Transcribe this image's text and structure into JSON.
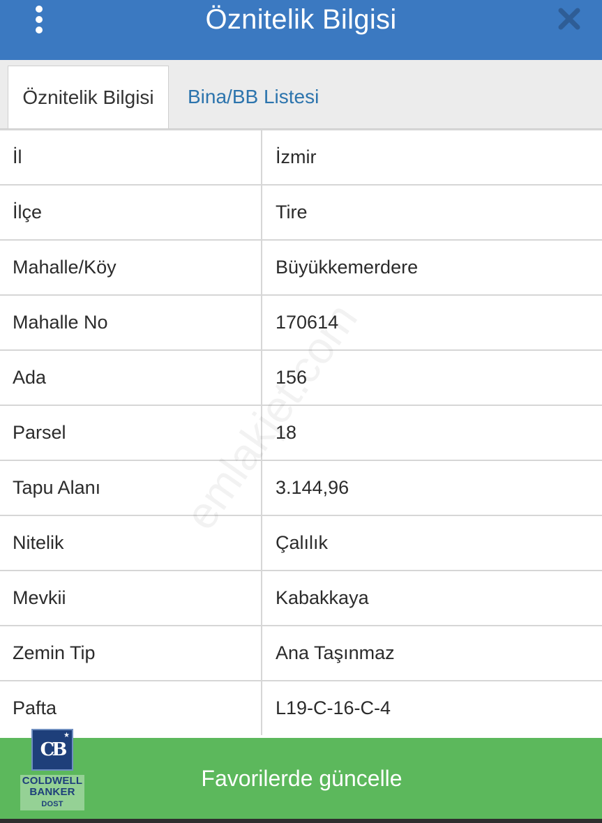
{
  "header": {
    "title": "Öznitelik Bilgisi",
    "menu_icon": "more-vertical-icon",
    "close_icon": "close-icon"
  },
  "tabs": [
    {
      "label": "Öznitelik Bilgisi",
      "active": true
    },
    {
      "label": "Bina/BB Listesi",
      "active": false
    }
  ],
  "attributes": [
    {
      "label": "İl",
      "value": "İzmir"
    },
    {
      "label": "İlçe",
      "value": "Tire"
    },
    {
      "label": "Mahalle/Köy",
      "value": "Büyükkemerdere"
    },
    {
      "label": "Mahalle No",
      "value": "170614"
    },
    {
      "label": "Ada",
      "value": "156"
    },
    {
      "label": "Parsel",
      "value": "18"
    },
    {
      "label": "Tapu Alanı",
      "value": "3.144,96"
    },
    {
      "label": "Nitelik",
      "value": "Çalılık"
    },
    {
      "label": "Mevkii",
      "value": "Kabakkaya"
    },
    {
      "label": "Zemin Tip",
      "value": "Ana Taşınmaz"
    },
    {
      "label": "Pafta",
      "value": "L19-C-16-C-4"
    }
  ],
  "watermark": "emlakjet.com",
  "footer": {
    "button_label": "Favorilerde güncelle"
  },
  "logo": {
    "monogram": "CB",
    "line1": "COLDWELL",
    "line2": "BANKER",
    "line3": "DOST"
  },
  "colors": {
    "header_bg": "#3b79c1",
    "tab_link": "#2c74ad",
    "footer_bg": "#5cb85c",
    "logo_blue": "#1e3f7a"
  }
}
